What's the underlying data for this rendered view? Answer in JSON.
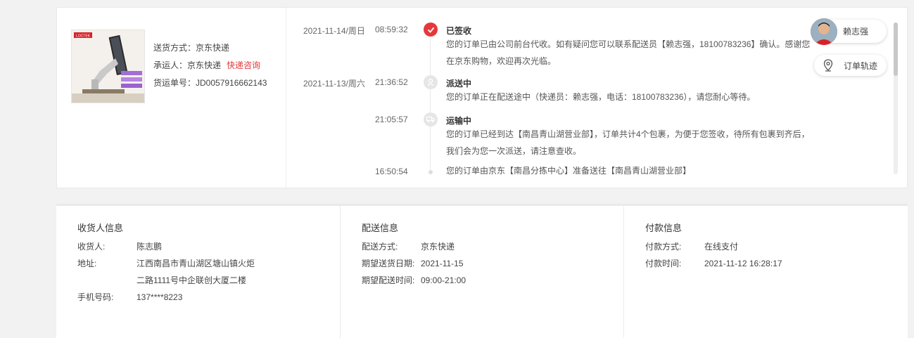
{
  "shipment": {
    "method_label": "送货方式：",
    "method": "京东快递",
    "carrier_label": "承运人：",
    "carrier": "京东快递",
    "carrier_link": "快递咨询",
    "tracking_label": "货运单号：",
    "tracking_no": "JD0057916662143",
    "product_brand": "LOCTEK"
  },
  "timeline": [
    {
      "date": "2021-11-14/周日",
      "time": "08:59:32",
      "status": "已签收",
      "desc": "您的订单已由公司前台代收。如有疑问您可以联系配送员【赖志强，18100783236】确认。感谢您在京东购物，欢迎再次光临。",
      "icon": "check-icon"
    },
    {
      "date": "2021-11-13/周六",
      "time": "21:36:52",
      "status": "派送中",
      "desc": "您的订单正在配送途中（快递员：赖志强，电话：18100783236），请您耐心等待。",
      "icon": "courier-icon"
    },
    {
      "date": "",
      "time": "21:05:57",
      "status": "运输中",
      "desc": "您的订单已经到达【南昌青山湖营业部】，订单共计4个包裹，为便于您签收，待所有包裹到齐后，我们会为您一次派送，请注意查收。",
      "icon": "truck-icon"
    },
    {
      "date": "",
      "time": "16:50:54",
      "status": "",
      "desc": "您的订单由京东【南昌分拣中心】准备送往【南昌青山湖营业部】",
      "icon": "dot"
    }
  ],
  "courier_button": {
    "name": "赖志强"
  },
  "track_button": {
    "label": "订单轨迹",
    "icon": "location-pin-icon"
  },
  "receiver": {
    "title": "收货人信息",
    "name_label": "收货人:",
    "name": "陈志鹏",
    "address_label": "地址:",
    "address_line1": "江西南昌市青山湖区塘山镇火炬",
    "address_line2": "二路1111号中企联创大厦二楼",
    "phone_label": "手机号码:",
    "phone": "137****8223"
  },
  "delivery": {
    "title": "配送信息",
    "method_label": "配送方式:",
    "method": "京东快递",
    "date_label": "期望送货日期:",
    "date": "2021-11-15",
    "time_label": "期望配送时间:",
    "time": "09:00-21:00"
  },
  "payment": {
    "title": "付款信息",
    "method_label": "付款方式:",
    "method": "在线支付",
    "time_label": "付款时间:",
    "time": "2021-11-12 16:28:17"
  },
  "colors": {
    "accent": "#e4393c"
  }
}
